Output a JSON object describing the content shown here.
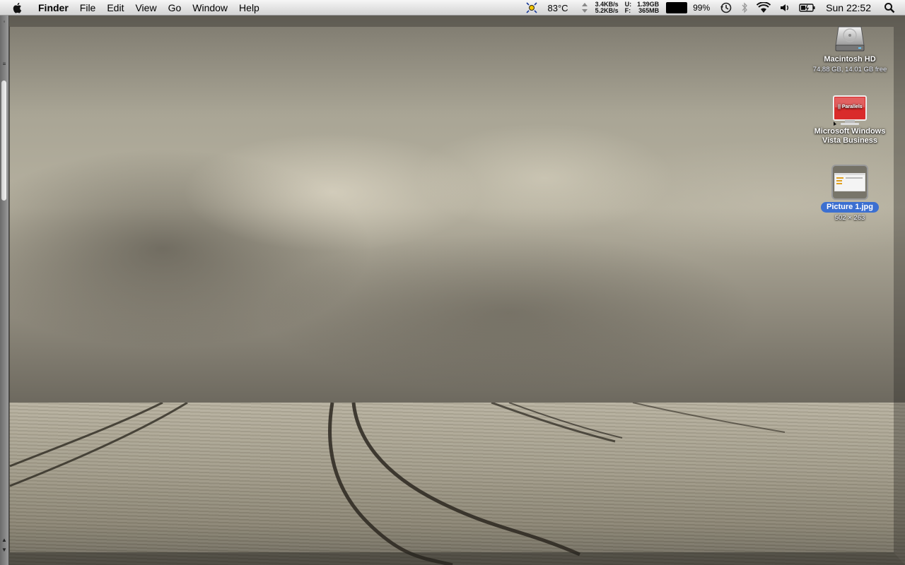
{
  "menubar": {
    "app_name": "Finder",
    "menus": [
      "File",
      "Edit",
      "View",
      "Go",
      "Window",
      "Help"
    ],
    "status": {
      "temperature": "83°C",
      "net_up": "3.4KB/s",
      "net_down": "5.2KB/s",
      "mem_used_label": "U:",
      "mem_used": "1.39GB",
      "mem_free_label": "F:",
      "mem_free": "365MB",
      "battery_percent": "99%",
      "clock": "Sun 22:52"
    },
    "icons": [
      "apple-icon",
      "istat-sun-icon",
      "updown-arrows-icon",
      "time-machine-icon",
      "bluetooth-icon",
      "wifi-icon",
      "volume-icon",
      "battery-icon",
      "spotlight-icon"
    ]
  },
  "desktop": {
    "items": [
      {
        "name": "Macintosh HD",
        "info": "74.88 GB, 14.01 GB free",
        "icon": "hard-drive-icon"
      },
      {
        "name": "Microsoft Windows Vista Business",
        "name_line1": "Microsoft Windows",
        "name_line2": "Vista Business",
        "icon": "parallels-vm-icon",
        "badge": "|| Parallels"
      },
      {
        "name": "Picture 1.jpg",
        "info": "502 × 263",
        "icon": "image-thumbnail-icon",
        "selected": true
      }
    ]
  },
  "colors": {
    "menubar": "#e3e3e3",
    "selection": "#3b6fd1",
    "parallels_red": "#d92b2b"
  }
}
